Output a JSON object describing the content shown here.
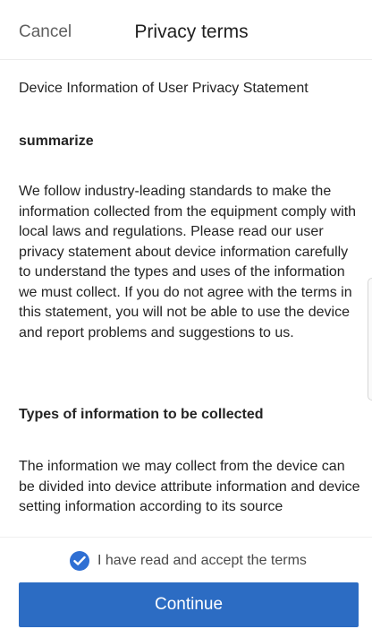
{
  "header": {
    "cancel_label": "Cancel",
    "title": "Privacy terms"
  },
  "content": {
    "intro": "Device Information of User Privacy Statement",
    "summary_heading": "summarize",
    "summary_text": "We follow industry-leading standards to make the information collected from the equipment comply with local laws and regulations. Please read our user privacy statement about device information carefully to understand the types and uses of the information we must collect. If you do not agree with the terms in this statement, you will not be able to use the device and report problems and suggestions to us.",
    "types_heading": "Types of information to be collected",
    "types_text": "The information we may collect from the device can be divided into device attribute information and device setting information according to its source"
  },
  "footer": {
    "accept_label": "I have read and accept the terms",
    "accept_checked": true,
    "continue_label": "Continue"
  },
  "colors": {
    "accent": "#2c6cc3",
    "checkbox": "#2f6fd3"
  }
}
